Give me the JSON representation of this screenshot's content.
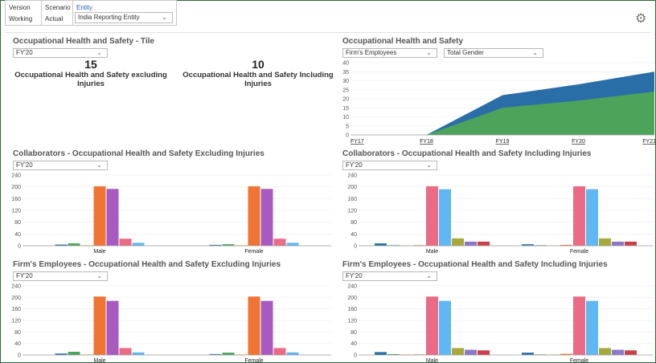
{
  "pov": {
    "version_header": "Version",
    "version_value": "Working",
    "scenario_header": "Scenario",
    "scenario_value": "Actual",
    "entity_header": "Entity",
    "entity_value": "India Reporting Entity"
  },
  "tile_panel": {
    "title": "Occupational Health and Safety - Tile",
    "period": "FY'20",
    "tiles": [
      {
        "value": "15",
        "label": "Occupational Health and Safety excluding Injuries"
      },
      {
        "value": "10",
        "label": "Occupational Health and Safety Including Injuries"
      }
    ]
  },
  "area_panel": {
    "title": "Occupational Health and Safety",
    "filter1": "Firm's Employees",
    "filter2": "Total Gender"
  },
  "collab_excl": {
    "title": "Collaborators - Occupational Health and Safety Excluding Injuries",
    "period": "FY'20"
  },
  "collab_incl": {
    "title": "Collaborators - Occupational Health and Safety Including Injuries",
    "period": "FY'20"
  },
  "emp_excl": {
    "title": "Firm's Employees - Occupational Health and Safety Excluding Injuries",
    "period": "FY'20"
  },
  "emp_incl": {
    "title": "Firm's Employees - Occupational Health and Safety Including Injuries",
    "period": "FY'20"
  },
  "chart_data": [
    {
      "type": "area",
      "x": [
        "FY17",
        "FY18",
        "FY19",
        "FY20",
        "FY21"
      ],
      "series": [
        {
          "values": [
            0,
            0,
            15,
            19,
            24
          ],
          "color": "#4ca35a"
        },
        {
          "values": [
            0,
            0,
            22,
            28,
            35
          ],
          "color": "#2a6ea8"
        }
      ],
      "ylim": [
        0,
        40
      ],
      "yticks": [
        "0",
        "5",
        "10",
        "15",
        "20",
        "25",
        "30",
        "35",
        "40"
      ],
      "link_labels": true
    },
    {
      "type": "bar",
      "categories": [
        "Male",
        "Female"
      ],
      "link_labels": true,
      "ylim": [
        0,
        240
      ],
      "yticks": [
        "0",
        "40",
        "80",
        "120",
        "160",
        "200",
        "240"
      ],
      "series": [
        {
          "color": "#2a6ea8",
          "values": [
            4,
            3
          ]
        },
        {
          "color": "#4ca35a",
          "values": [
            8,
            5
          ]
        },
        {
          "color": "#f3c04a",
          "values": [
            2,
            2
          ]
        },
        {
          "color": "#f07535",
          "values": [
            202,
            202
          ]
        },
        {
          "color": "#a75bc1",
          "values": [
            193,
            193
          ]
        },
        {
          "color": "#ea6b84",
          "values": [
            24,
            24
          ]
        },
        {
          "color": "#5fb8f2",
          "values": [
            10,
            10
          ]
        }
      ]
    },
    {
      "type": "bar",
      "categories": [
        "Male",
        "Female"
      ],
      "link_labels": true,
      "ylim": [
        0,
        240
      ],
      "yticks": [
        "0",
        "40",
        "80",
        "120",
        "160",
        "200",
        "240"
      ],
      "series": [
        {
          "color": "#2a6ea8",
          "values": [
            8,
            5
          ]
        },
        {
          "color": "#4ca35a",
          "values": [
            2,
            2
          ]
        },
        {
          "color": "#f3c04a",
          "values": [
            1,
            1
          ]
        },
        {
          "color": "#f07535",
          "values": [
            2,
            3
          ]
        },
        {
          "color": "#ea6b84",
          "values": [
            202,
            202
          ]
        },
        {
          "color": "#5fb8f2",
          "values": [
            192,
            192
          ]
        },
        {
          "color": "#a7a93a",
          "values": [
            25,
            25
          ]
        },
        {
          "color": "#8a78c8",
          "values": [
            14,
            14
          ]
        },
        {
          "color": "#c94048",
          "values": [
            14,
            14
          ]
        }
      ]
    },
    {
      "type": "bar",
      "categories": [
        "Male",
        "Female"
      ],
      "link_labels": false,
      "ylim": [
        0,
        240
      ],
      "yticks": [
        "0",
        "40",
        "80",
        "120",
        "160",
        "200",
        "240"
      ],
      "series": [
        {
          "color": "#2a6ea8",
          "values": [
            5,
            3
          ]
        },
        {
          "color": "#4ca35a",
          "values": [
            11,
            8
          ]
        },
        {
          "color": "#f3c04a",
          "values": [
            2,
            2
          ]
        },
        {
          "color": "#f07535",
          "values": [
            203,
            203
          ]
        },
        {
          "color": "#a75bc1",
          "values": [
            188,
            188
          ]
        },
        {
          "color": "#ea6b84",
          "values": [
            24,
            24
          ]
        },
        {
          "color": "#5fb8f2",
          "values": [
            9,
            9
          ]
        }
      ]
    },
    {
      "type": "bar",
      "categories": [
        "Male",
        "Female"
      ],
      "link_labels": false,
      "ylim": [
        0,
        240
      ],
      "yticks": [
        "0",
        "40",
        "80",
        "120",
        "160",
        "200",
        "240"
      ],
      "series": [
        {
          "color": "#2a6ea8",
          "values": [
            10,
            8
          ]
        },
        {
          "color": "#4ca35a",
          "values": [
            3,
            2
          ]
        },
        {
          "color": "#f3c04a",
          "values": [
            2,
            2
          ]
        },
        {
          "color": "#f07535",
          "values": [
            2,
            4
          ]
        },
        {
          "color": "#ea6b84",
          "values": [
            203,
            203
          ]
        },
        {
          "color": "#5fb8f2",
          "values": [
            188,
            188
          ]
        },
        {
          "color": "#a7a93a",
          "values": [
            24,
            24
          ]
        },
        {
          "color": "#8a78c8",
          "values": [
            18,
            18
          ]
        },
        {
          "color": "#c94048",
          "values": [
            16,
            16
          ]
        }
      ]
    }
  ]
}
